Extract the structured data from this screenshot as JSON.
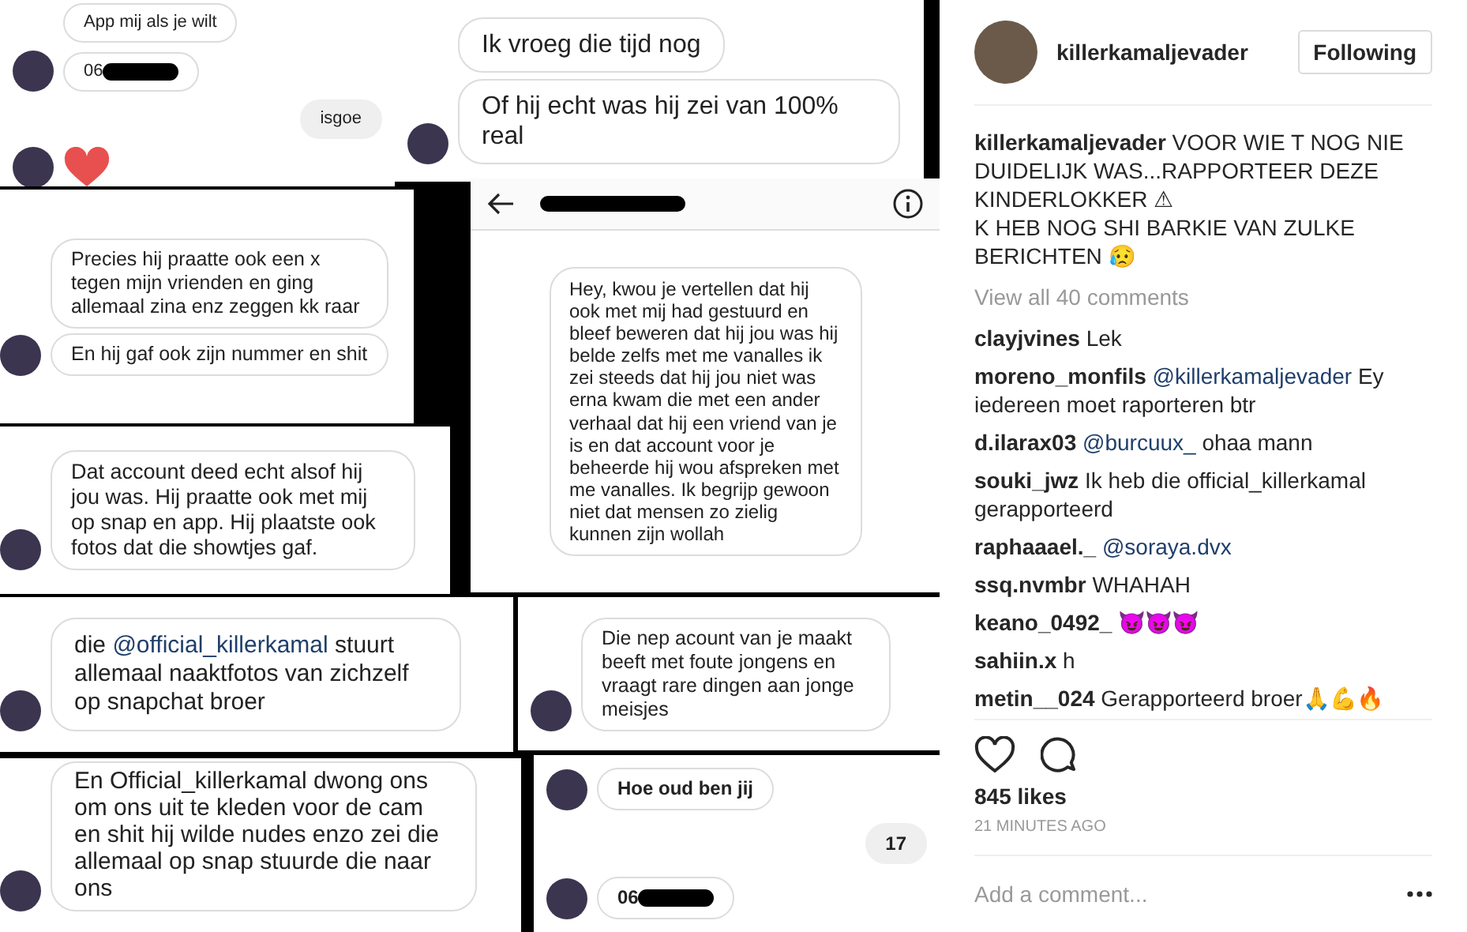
{
  "post_image": {
    "panels": [
      {
        "messages": [
          {
            "kind": "received",
            "avatar": false,
            "text": "App mij als je wilt"
          },
          {
            "kind": "received",
            "avatar": true,
            "text": "06",
            "redacted": true
          },
          {
            "kind": "sent",
            "avatar": false,
            "text": "isgoe"
          },
          {
            "kind": "heart",
            "avatar": true
          }
        ]
      },
      {
        "messages": [
          {
            "kind": "received",
            "avatar": false,
            "text": "Ik vroeg die tijd nog"
          },
          {
            "kind": "received",
            "avatar": true,
            "text": "Of hij echt was hij zei van 100% real"
          }
        ]
      },
      {
        "header": {
          "redacted": true
        },
        "messages": [
          {
            "kind": "received",
            "avatar": false,
            "text": "Hey, kwou je vertellen dat hij ook met mij had gestuurd en bleef beweren dat hij jou was hij belde zelfs met me vanalles ik zei steeds dat hij jou niet was erna kwam die met een ander verhaal dat hij een vriend van je is en dat account voor je beheerde hij wou afspreken met me vanalles. Ik begrijp gewoon niet dat mensen zo zielig kunnen zijn wollah"
          }
        ]
      },
      {
        "messages": [
          {
            "kind": "received",
            "avatar": false,
            "text": "Precies hij praatte ook een x tegen mijn vrienden en ging allemaal zina enz zeggen kk raar"
          },
          {
            "kind": "received",
            "avatar": true,
            "text": "En hij gaf ook zijn nummer en shit"
          }
        ]
      },
      {
        "messages": [
          {
            "kind": "received",
            "avatar": true,
            "text": "Dat account deed echt alsof hij jou was. Hij praatte ook met mij op snap en app. Hij plaatste ook fotos dat die showtjes gaf."
          }
        ]
      },
      {
        "messages": [
          {
            "kind": "received",
            "avatar": true,
            "text": "die",
            "mention": "@official_killerkamal",
            "rest": "stuurt allemaal naaktfotos van zichzelf op snapchat broer"
          }
        ]
      },
      {
        "messages": [
          {
            "kind": "received",
            "avatar": true,
            "text": "Die nep acount van je maakt beeft met foute jongens en vraagt rare dingen aan jonge meisjes"
          }
        ]
      },
      {
        "messages": [
          {
            "kind": "received",
            "avatar": true,
            "text": "En Official_killerkamal dwong ons om ons uit te kleden voor de cam en shit hij wilde nudes enzo zei die allemaal op snap stuurde die naar ons"
          }
        ]
      },
      {
        "messages": [
          {
            "kind": "received",
            "avatar": true,
            "text": "Hoe oud ben jij"
          },
          {
            "kind": "sent",
            "avatar": false,
            "text": "17"
          },
          {
            "kind": "received",
            "avatar": true,
            "text": "06",
            "redacted": true
          }
        ]
      }
    ]
  },
  "header": {
    "username": "killerkamaljevader",
    "follow_button": "Following"
  },
  "caption": {
    "username": "killerkamaljevader",
    "text": "VOOR WIE T NOG NIE DUIDELIJK WAS...RAPPORTEER DEZE KINDERLOKKER ⚠\nK HEB NOG SHI BARKIE VAN ZULKE BERICHTEN 😥"
  },
  "view_all_comments": "View all 40 comments",
  "comments": [
    {
      "username": "clayjvines",
      "text": "Lek"
    },
    {
      "username": "moreno_monfils",
      "mention": "@killerkamaljevader",
      "text": "Ey iedereen moet raporteren btr"
    },
    {
      "username": "d.ilarax03",
      "mention": "@burcuux_",
      "text": "ohaa mann"
    },
    {
      "username": "souki_jwz",
      "text": "Ik heb die official_killerkamal gerapporteerd"
    },
    {
      "username": "raphaaael._",
      "mention": "@soraya.dvx"
    },
    {
      "username": "ssq.nvmbr",
      "text": "WHAHAH"
    },
    {
      "username": "keano_0492_",
      "text": "😈😈😈"
    },
    {
      "username": "sahiin.x",
      "text": "h"
    },
    {
      "username": "metin__024",
      "text": "Gerapporteerd broer🙏💪🔥"
    }
  ],
  "likes": "845 likes",
  "time": "21 MINUTES AGO",
  "comment_box": {
    "placeholder": "Add a comment..."
  }
}
